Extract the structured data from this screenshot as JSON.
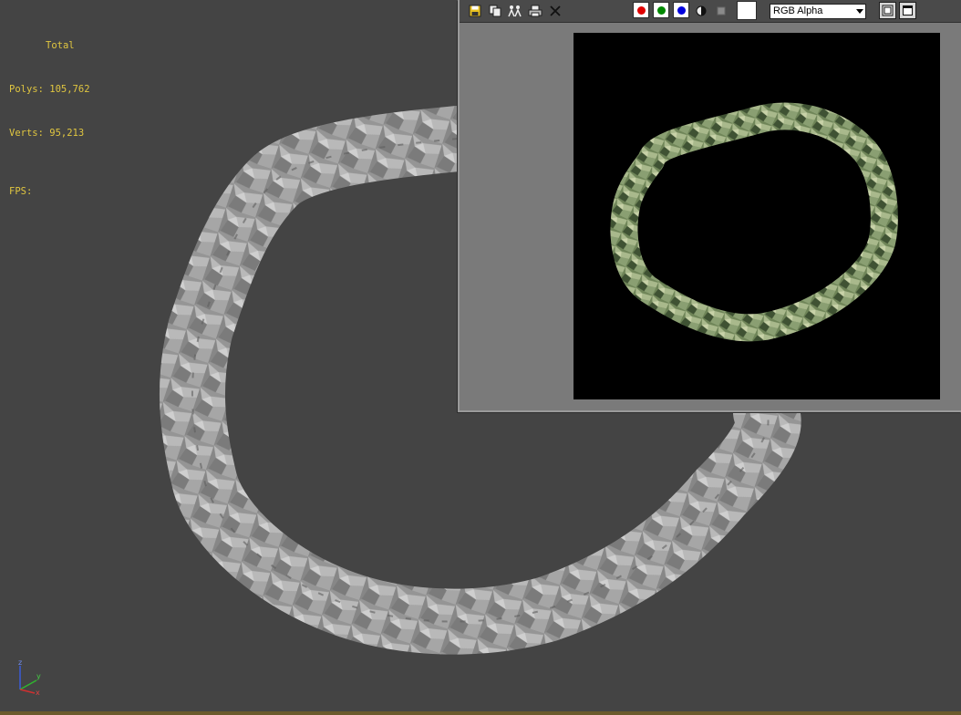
{
  "viewport": {
    "stats": {
      "title": "Total",
      "polys_label": "Polys:",
      "polys_value": "105,762",
      "verts_label": "Verts:",
      "verts_value": "95,213",
      "fps_label": "FPS:"
    },
    "axis": {
      "z": "z",
      "y": "y",
      "x": "x"
    },
    "colors": {
      "background": "#444444",
      "stats_text": "#e0c640",
      "mesh": "#9a9a9a"
    }
  },
  "render_window": {
    "toolbar": {
      "save_icon": "floppy-disk-icon",
      "copy_icon": "copy-icon",
      "clone_icon": "clone-window-icon",
      "print_icon": "print-icon",
      "clear_icon": "clear-x-icon",
      "channels": [
        {
          "name": "red-channel",
          "color": "#e00000"
        },
        {
          "name": "green-channel",
          "color": "#008800"
        },
        {
          "name": "blue-channel",
          "color": "#0000dd"
        }
      ],
      "mono_icon": "monochrome-icon",
      "alpha_icon": "alpha-channel-icon",
      "channel_display": "RGB Alpha"
    },
    "colors": {
      "background": "#7a7a7a",
      "canvas": "#000000",
      "rock": "#7d9068"
    }
  }
}
